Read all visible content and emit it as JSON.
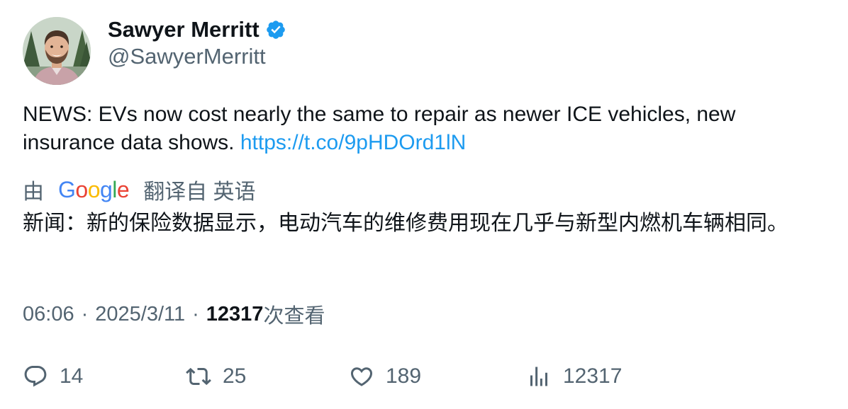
{
  "author": {
    "display_name": "Sawyer Merritt",
    "handle": "@SawyerMerritt",
    "verified": true
  },
  "tweet": {
    "text": "NEWS: EVs now cost nearly the same to repair as newer ICE vehicles, new insurance data shows. ",
    "link": "https://t.co/9pHDOrd1lN"
  },
  "translation": {
    "prefix": "由",
    "provider_letters": [
      {
        "char": "G",
        "color": "#4285F4"
      },
      {
        "char": "o",
        "color": "#EA4335"
      },
      {
        "char": "o",
        "color": "#FBBC05"
      },
      {
        "char": "g",
        "color": "#4285F4"
      },
      {
        "char": "l",
        "color": "#34A853"
      },
      {
        "char": "e",
        "color": "#EA4335"
      }
    ],
    "suffix": "翻译自 英语",
    "text": "新闻：新的保险数据显示，电动汽车的维修费用现在几乎与新型内燃机车辆相同。"
  },
  "meta": {
    "time": "06:06",
    "separator": "·",
    "date": "2025/3/11",
    "views_count": "12317",
    "views_label": "次查看"
  },
  "actions": {
    "replies": "14",
    "retweets": "25",
    "likes": "189",
    "views": "12317"
  },
  "colors": {
    "link": "#1d9bf0",
    "verified": "#1d9bf0",
    "secondary_text": "#536471",
    "primary_text": "#0f1419"
  },
  "icons": {
    "verified": "verified-badge-icon",
    "reply": "reply-icon",
    "retweet": "retweet-icon",
    "like": "heart-icon",
    "views": "analytics-icon"
  }
}
